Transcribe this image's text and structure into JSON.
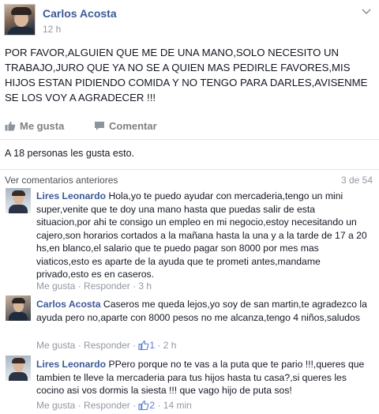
{
  "post": {
    "author": "Carlos Acosta",
    "time": "12 h",
    "text": "POR FAVOR,ALGUIEN QUE ME DE UNA MANO,SOLO NECESITO UN TRABAJO,JURO QUE YA NO SE A QUIEN MAS PEDIRLE FAVORES,MIS HIJOS ESTAN PIDIENDO COMIDA Y NO TENGO PARA DARLES,AVISENME SE LOS VOY A AGRADECER !!!"
  },
  "actions": {
    "like_label": "Me gusta",
    "comment_label": "Comentar"
  },
  "likes": {
    "prefix": "A ",
    "link": "18 personas",
    "suffix": " les gusta esto."
  },
  "comments_header": {
    "previous_label": "Ver comentarios anteriores",
    "count": "3 de 54"
  },
  "comments": [
    {
      "author": "Lires Leonardo",
      "text": "Hola,yo te puedo ayudar con mercaderia,tengo un mini super,venite que te doy una mano hasta que puedas salir de esta situacion,por ahi te consigo un empleo en mi negocio,estoy necesitando un cajero,son horarios cortados a la mañana hasta la una y a la tarde de 17 a 20 hs,en blanco,el salario que te puedo pagar son 8000 por mes mas viaticos,esto es aparte de la ayuda que te prometi antes,mandame privado,esto es en caseros.",
      "like_label": "Me gusta",
      "reply_label": "Responder",
      "likes_count": "",
      "time": "3 h"
    },
    {
      "author": "Carlos Acosta",
      "text": "Caseros me queda lejos,yo soy de san martin,te agradezco la ayuda pero no,aparte con 8000 pesos no me alcanza,tengo 4 niños,saludos",
      "like_label": "Me gusta",
      "reply_label": "Responder",
      "likes_count": "1",
      "time": "2 h"
    },
    {
      "author": "Lires Leonardo",
      "text": "PPero porque no te vas a la puta que te pario !!!,queres que tambien te lleve la mercaderia para tus hijos hasta tu casa?,si queres les cocino asi vos dormis la siesta !!! que vago hijo de puta sos!",
      "like_label": "Me gusta",
      "reply_label": "Responder",
      "likes_count": "2",
      "time": "14 min"
    }
  ],
  "separator": " · ",
  "colors": {
    "link": "#3b5998",
    "muted": "#9197a3",
    "text": "#141823"
  },
  "icons": [
    "chevron-down-icon",
    "thumbs-up-icon",
    "comment-icon",
    "like-count-icon"
  ]
}
